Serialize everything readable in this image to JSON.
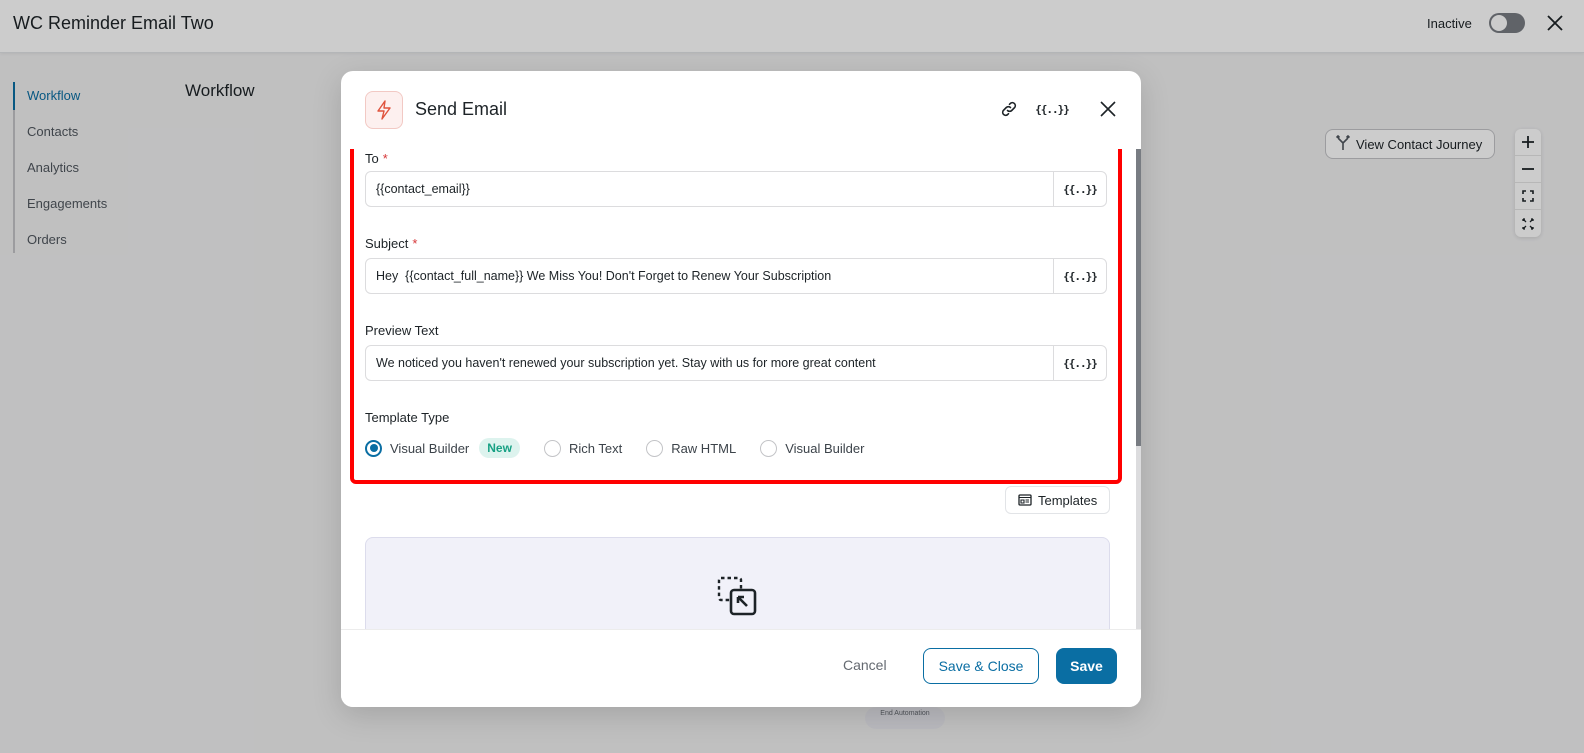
{
  "app": {
    "title": "WC Reminder Email Two",
    "status_label": "Inactive",
    "status_active": false
  },
  "sidebar": {
    "items": [
      {
        "label": "Workflow",
        "active": true
      },
      {
        "label": "Contacts",
        "active": false
      },
      {
        "label": "Analytics",
        "active": false
      },
      {
        "label": "Engagements",
        "active": false
      },
      {
        "label": "Orders",
        "active": false
      }
    ]
  },
  "canvas": {
    "section_title": "Workflow",
    "journey_button": "View Contact Journey",
    "zoom_controls": [
      "zoom-in",
      "zoom-out",
      "fit-view",
      "fullscreen"
    ],
    "end_chip": "End Automation"
  },
  "modal": {
    "title": "Send Email",
    "icon": "lightning-icon",
    "header_actions": {
      "link_icon": "link-icon",
      "vars_label": "{{..}}",
      "close_icon": "close-icon"
    },
    "fields": {
      "to": {
        "label": "To",
        "required": true,
        "value": "{{contact_email}}",
        "vars_label": "{{..}}"
      },
      "subject": {
        "label": "Subject",
        "required": true,
        "value": "Hey  {{contact_full_name}} We Miss You! Don't Forget to Renew Your Subscription",
        "vars_label": "{{..}}"
      },
      "preview": {
        "label": "Preview Text",
        "required": false,
        "value": "We noticed you haven't renewed your subscription yet. Stay with us for more great content",
        "vars_label": "{{..}}"
      }
    },
    "template_type": {
      "label": "Template Type",
      "options": [
        {
          "label": "Visual Builder",
          "checked": true,
          "badge": "New"
        },
        {
          "label": "Rich Text",
          "checked": false
        },
        {
          "label": "Raw HTML",
          "checked": false
        },
        {
          "label": "Visual Builder",
          "checked": false
        }
      ]
    },
    "templates_button": "Templates",
    "footer": {
      "cancel": "Cancel",
      "save_close": "Save & Close",
      "save": "Save"
    }
  },
  "colors": {
    "primary": "#0a6ea3",
    "highlight": "#ff0000",
    "badge_bg": "#ddf3ee",
    "badge_text": "#17a184",
    "icon_accent": "#e0533d"
  }
}
